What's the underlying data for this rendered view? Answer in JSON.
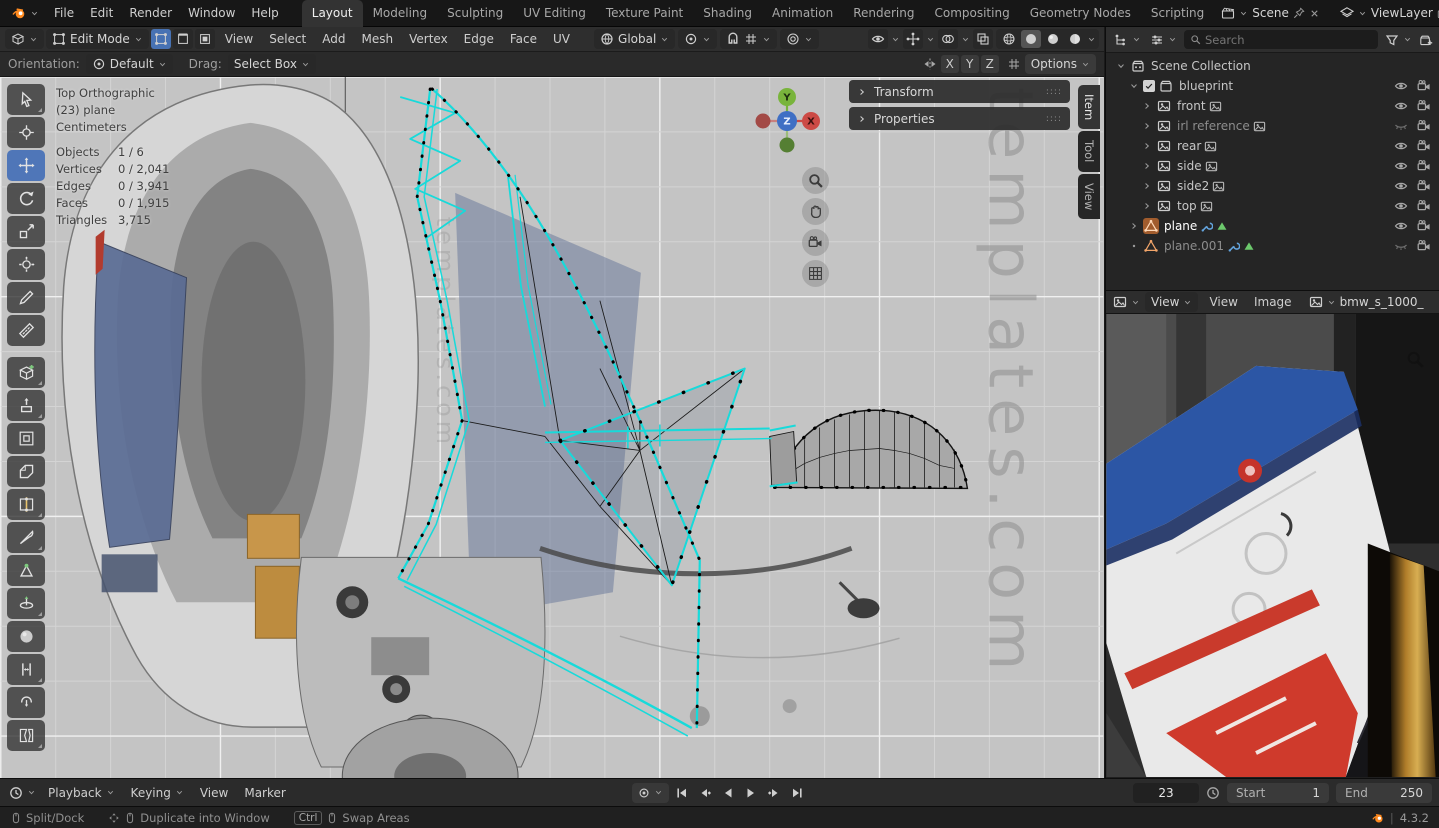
{
  "colors": {
    "accent": "#4772b3",
    "selection_cyan": "#17dada",
    "viewport_bg": "#c4c4c4"
  },
  "topbar": {
    "menus": [
      "File",
      "Edit",
      "Render",
      "Window",
      "Help"
    ],
    "workspaces": [
      "Layout",
      "Modeling",
      "Sculpting",
      "UV Editing",
      "Texture Paint",
      "Shading",
      "Animation",
      "Rendering",
      "Compositing",
      "Geometry Nodes",
      "Scripting"
    ],
    "active_workspace": "Layout",
    "scene_name": "Scene",
    "view_layer_name": "ViewLayer"
  },
  "viewport_header": {
    "mode": "Edit Mode",
    "menus": [
      "View",
      "Select",
      "Add",
      "Mesh",
      "Vertex",
      "Edge",
      "Face",
      "UV"
    ],
    "orientation": "Global",
    "select_modes": [
      "vertex",
      "edge",
      "face"
    ],
    "active_select_mode": "vertex",
    "right_icons": [
      "visibility",
      "gizmos",
      "overlays",
      "xray"
    ],
    "shading_modes": [
      "wireframe",
      "solid",
      "material",
      "rendered"
    ],
    "active_shading": "solid"
  },
  "tool_settings": {
    "orientation_label": "Orientation:",
    "orientation_value": "Default",
    "drag_label": "Drag:",
    "drag_value": "Select Box",
    "mirror_axes": [
      "X",
      "Y",
      "Z"
    ],
    "options_label": "Options"
  },
  "tools": [
    "tweak-select",
    "cursor",
    "move",
    "rotate",
    "scale",
    "transform",
    "annotate",
    "measure",
    "add-cube",
    "extrude",
    "inset-faces",
    "bevel",
    "loop-cut",
    "knife",
    "poly-build",
    "spin",
    "smooth",
    "edge-slide",
    "shrink-fatten",
    "rip-region"
  ],
  "active_tool": "move",
  "viewport": {
    "view_label": "Top Orthographic",
    "object_label": "(23) plane",
    "units_label": "Centimeters",
    "stats": [
      {
        "label": "Objects",
        "value": "1 / 6"
      },
      {
        "label": "Vertices",
        "value": "0 / 2,041"
      },
      {
        "label": "Edges",
        "value": "0 / 3,941"
      },
      {
        "label": "Faces",
        "value": "0 / 1,915"
      },
      {
        "label": "Triangles",
        "value": "3,715"
      }
    ],
    "panels": [
      "Transform",
      "Properties"
    ],
    "region_tabs": [
      "Item",
      "Tool",
      "View"
    ],
    "active_region_tab": "Item",
    "axis_labels": {
      "x": "X",
      "y": "Y",
      "z": "Z"
    },
    "watermark": "templates.com"
  },
  "outliner": {
    "search_placeholder": "Search",
    "rows": [
      {
        "name": "Scene Collection",
        "icon": "scenecoll",
        "indent": 0,
        "disc": "open"
      },
      {
        "name": "blueprint",
        "icon": "collection",
        "indent": 1,
        "disc": "open",
        "checkbox": true,
        "eye": "open",
        "camera": true
      },
      {
        "name": "front",
        "icon": "image",
        "indent": 2,
        "disc": "closed",
        "badge": true,
        "eye": "open",
        "camera": true
      },
      {
        "name": "irl reference",
        "icon": "image",
        "indent": 2,
        "disc": "closed",
        "badge": true,
        "muted": true,
        "eye": "closed",
        "camera": true
      },
      {
        "name": "rear",
        "icon": "image",
        "indent": 2,
        "disc": "closed",
        "badge": true,
        "eye": "open",
        "camera": true
      },
      {
        "name": "side",
        "icon": "image",
        "indent": 2,
        "disc": "closed",
        "badge": true,
        "eye": "open",
        "camera": true
      },
      {
        "name": "side2",
        "icon": "image",
        "indent": 2,
        "disc": "closed",
        "badge": true,
        "eye": "open",
        "camera": true
      },
      {
        "name": "top",
        "icon": "image",
        "indent": 2,
        "disc": "closed",
        "badge": true,
        "eye": "open",
        "camera": true
      },
      {
        "name": "plane",
        "icon": "mesh",
        "indent": 1,
        "disc": "closed",
        "active": true,
        "mods": true,
        "eye": "open",
        "camera": true
      },
      {
        "name": "plane.001",
        "icon": "mesh",
        "indent": 1,
        "disc": "dot",
        "muted": true,
        "mods": true,
        "eye": "closed",
        "camera": true
      }
    ]
  },
  "image_editor": {
    "mode": "View",
    "menus": [
      "View",
      "Image"
    ],
    "image_name": "bmw_s_1000_"
  },
  "timeline": {
    "menus": [
      {
        "label": "Playback",
        "caret": true
      },
      {
        "label": "Keying",
        "caret": true
      },
      {
        "label": "View",
        "caret": false
      },
      {
        "label": "Marker",
        "caret": false
      }
    ],
    "transport": [
      "jump-start",
      "prev-keyframe",
      "play-reverse",
      "play",
      "next-keyframe",
      "jump-end"
    ],
    "current_frame": "23",
    "start_label": "Start",
    "start_value": "1",
    "end_label": "End",
    "end_value": "250"
  },
  "status_bar": {
    "hints": [
      {
        "keys": [
          "mouse"
        ],
        "label": "Split/Dock"
      },
      {
        "keys": [
          "arrows",
          "mouse"
        ],
        "label": "Duplicate into Window"
      },
      {
        "keys": [
          "Ctrl",
          "mouse"
        ],
        "label": "Swap Areas"
      }
    ],
    "version": "4.3.2"
  }
}
